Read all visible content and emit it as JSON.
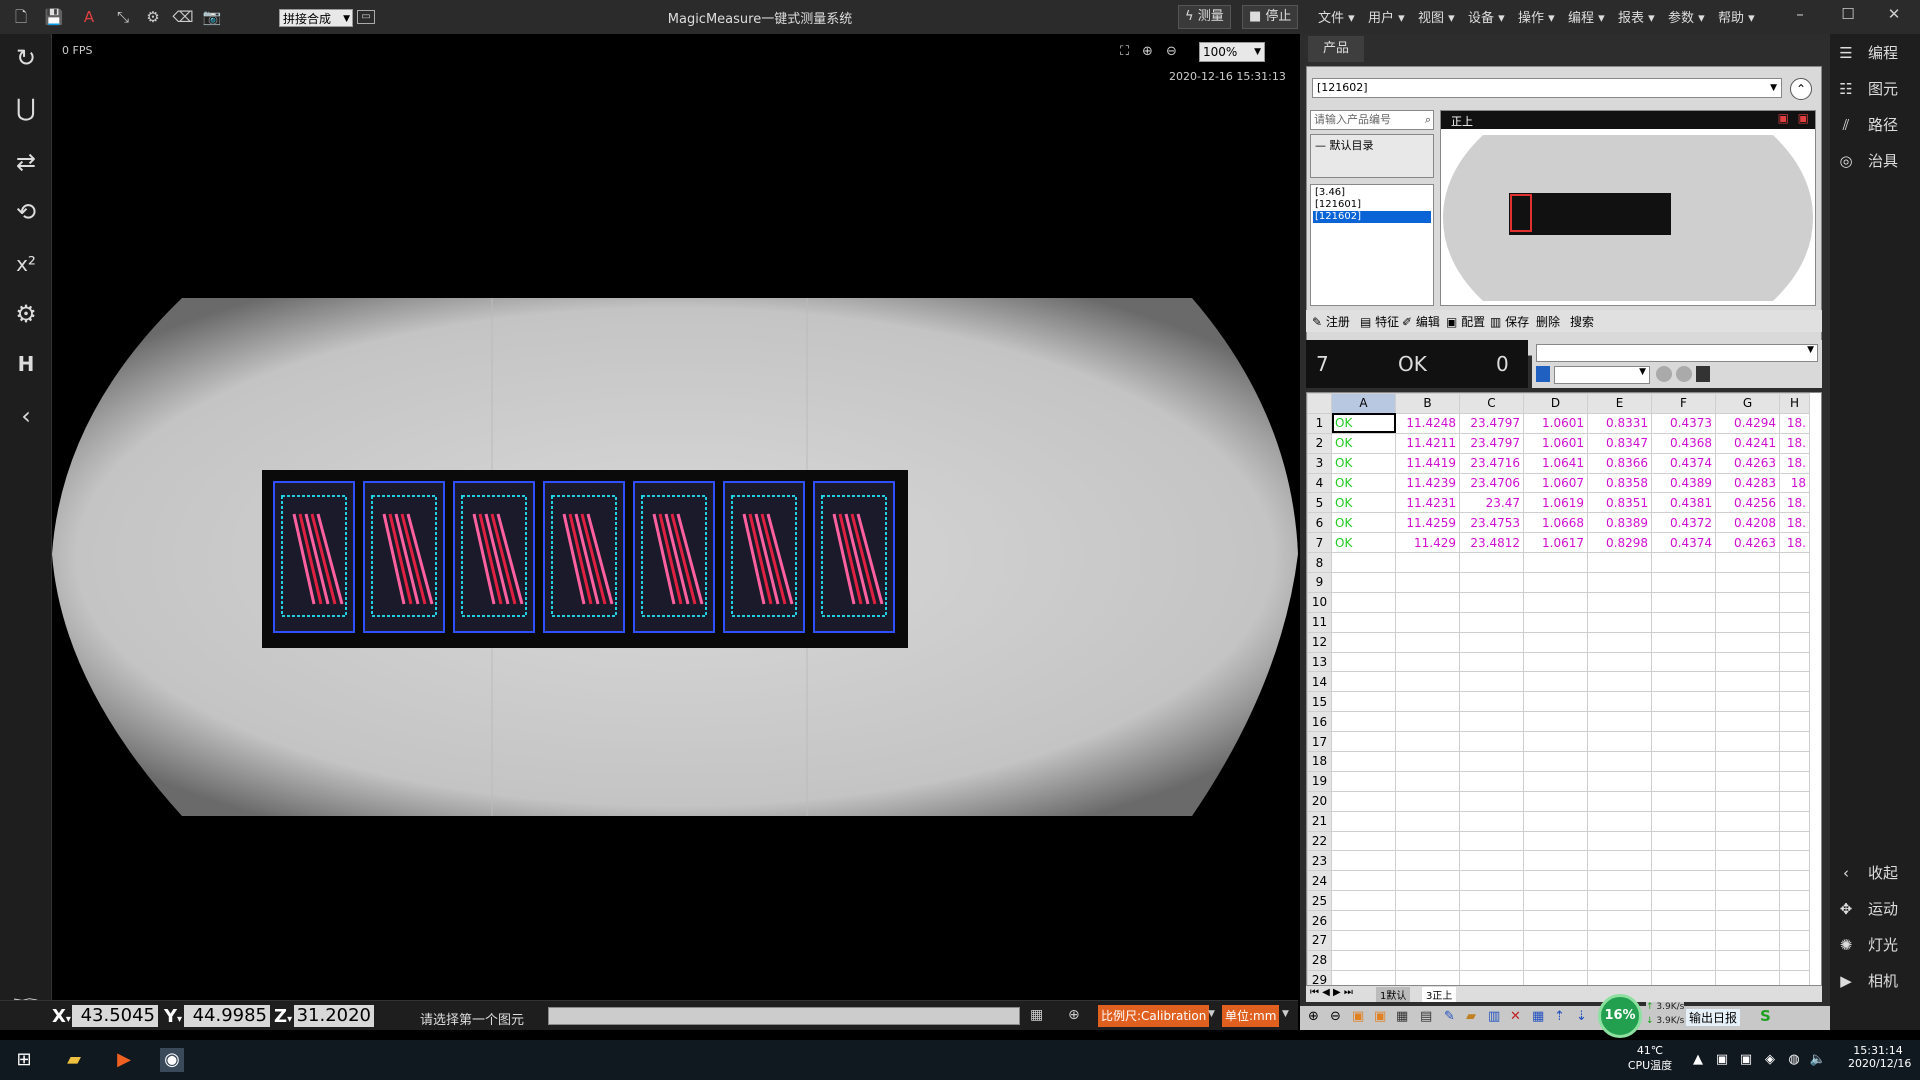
{
  "window": {
    "title": "MagicMeasure一键式测量系统",
    "mode_select": "拼接合成",
    "measure_btn": "测量",
    "stop_btn": "停止"
  },
  "menus": [
    "文件",
    "用户",
    "视图",
    "设备",
    "操作",
    "编程",
    "报表",
    "参数",
    "帮助"
  ],
  "viewport": {
    "fps": "0 FPS",
    "zoom": "100%",
    "datetime": "2020-12-16 15:31:13"
  },
  "coords": {
    "x_label": "X",
    "x": "43.5045",
    "y_label": "Y",
    "y": "44.9985",
    "z_label": "Z",
    "z": "31.2020",
    "prompt": "请选择第一个图元",
    "scale": "比例尺:Calibration",
    "unit": "单位:mm"
  },
  "product": {
    "tab": "产品",
    "selected": "[121602]",
    "search_placeholder": "请输入产品编号",
    "tree_root": "默认目录",
    "list": [
      "[3.46]",
      "[121601]",
      "[121602]"
    ],
    "selected_index": 2,
    "preview_label": "正上",
    "actions": [
      "注册",
      "特征",
      "编辑",
      "配置",
      "保存",
      "删除",
      "搜索"
    ]
  },
  "counter": {
    "total": "7",
    "status": "OK",
    "ng": "0"
  },
  "grid": {
    "columns": [
      "A",
      "B",
      "C",
      "D",
      "E",
      "F",
      "G",
      "H"
    ],
    "rows": [
      [
        "OK",
        "11.4248",
        "23.4797",
        "1.0601",
        "0.8331",
        "0.4373",
        "0.4294",
        "18."
      ],
      [
        "OK",
        "11.4211",
        "23.4797",
        "1.0601",
        "0.8347",
        "0.4368",
        "0.4241",
        "18."
      ],
      [
        "OK",
        "11.4419",
        "23.4716",
        "1.0641",
        "0.8366",
        "0.4374",
        "0.4263",
        "18."
      ],
      [
        "OK",
        "11.4239",
        "23.4706",
        "1.0607",
        "0.8358",
        "0.4389",
        "0.4283",
        "18"
      ],
      [
        "OK",
        "11.4231",
        "23.47",
        "1.0619",
        "0.8351",
        "0.4381",
        "0.4256",
        "18."
      ],
      [
        "OK",
        "11.4259",
        "23.4753",
        "1.0668",
        "0.8389",
        "0.4372",
        "0.4208",
        "18."
      ],
      [
        "OK",
        "11.429",
        "23.4812",
        "1.0617",
        "0.8298",
        "0.4374",
        "0.4263",
        "18."
      ]
    ],
    "total_rows": 29,
    "sheet_tabs": [
      "1默认",
      "3正上"
    ]
  },
  "performance": {
    "cpu": "16%",
    "up": "3.9K/s",
    "down": "3.9K/s"
  },
  "side_nav": [
    "编程",
    "图元",
    "路径",
    "治具"
  ],
  "side_nav_bottom": [
    "收起",
    "运动",
    "灯光",
    "相机"
  ],
  "bottom_log": "输出日报",
  "taskbar": {
    "temp": "41℃",
    "temp_label": "CPU温度",
    "time": "15:31:14",
    "date": "2020/12/16"
  },
  "colors": {
    "ok": "#22cc22",
    "value": "#d010d0",
    "accent": "#e06020",
    "selected": "#0a64d6"
  }
}
